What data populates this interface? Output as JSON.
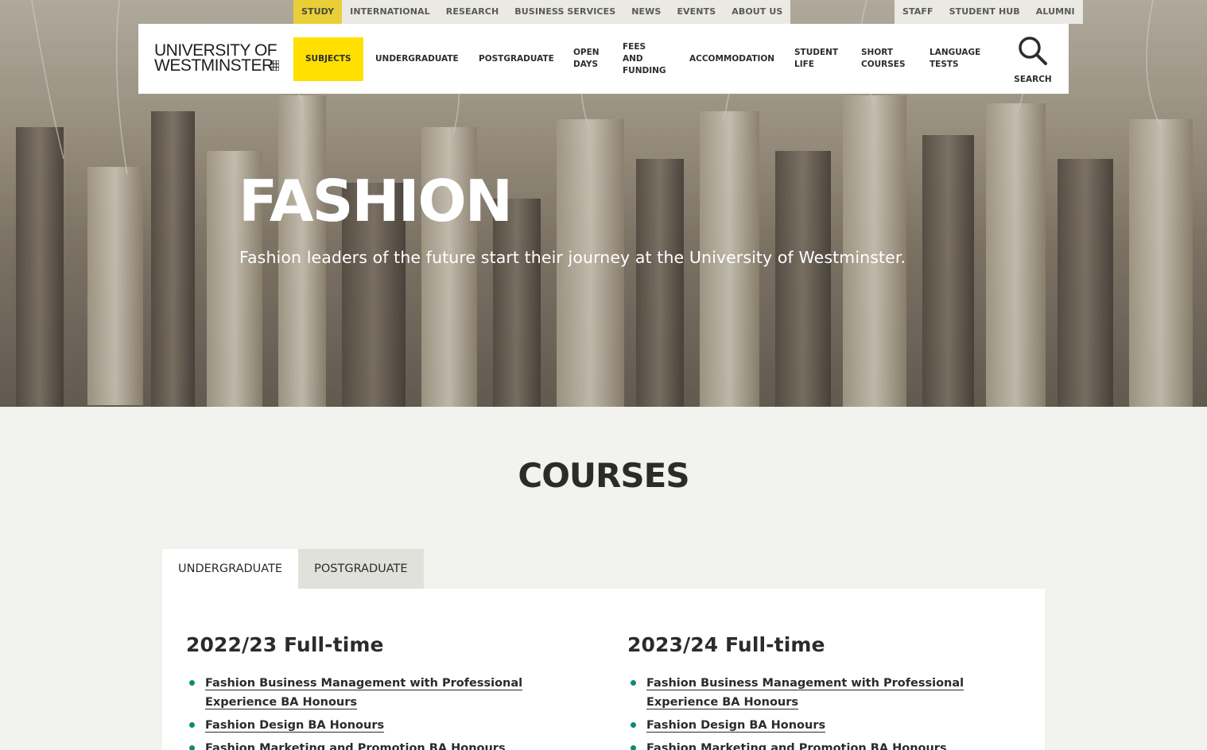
{
  "utility_left": [
    {
      "label": "STUDY",
      "active": true
    },
    {
      "label": "INTERNATIONAL"
    },
    {
      "label": "RESEARCH"
    },
    {
      "label": "BUSINESS SERVICES"
    },
    {
      "label": "NEWS"
    },
    {
      "label": "EVENTS"
    },
    {
      "label": "ABOUT US"
    }
  ],
  "utility_right": [
    {
      "label": "STAFF"
    },
    {
      "label": "STUDENT HUB"
    },
    {
      "label": "ALUMNI"
    }
  ],
  "logo": {
    "line1": "UNIVERSITY OF",
    "line2": "WESTMINSTER"
  },
  "nav": [
    {
      "label": "SUBJECTS",
      "active": true
    },
    {
      "label": "UNDERGRADUATE"
    },
    {
      "label": "POSTGRADUATE"
    },
    {
      "label": "OPEN\nDAYS"
    },
    {
      "label": "FEES\nAND\nFUNDING"
    },
    {
      "label": "ACCOMMODATION"
    },
    {
      "label": "STUDENT\nLIFE"
    },
    {
      "label": "SHORT\nCOURSES"
    },
    {
      "label": "LANGUAGE\nTESTS"
    }
  ],
  "search": {
    "label": "SEARCH",
    "icon": "search-icon"
  },
  "hero": {
    "title": "FASHION",
    "subtitle": "Fashion leaders of the future start their journey at the University of Westminster."
  },
  "courses": {
    "title": "COURSES",
    "tabs": [
      {
        "label": "UNDERGRADUATE",
        "active": true
      },
      {
        "label": "POSTGRADUATE"
      }
    ],
    "columns": [
      {
        "heading": "2022/23 Full-time",
        "items": [
          "Fashion Business Management with Professional Experience BA Honours",
          "Fashion Design BA Honours",
          "Fashion Marketing and Promotion BA Honours"
        ]
      },
      {
        "heading": "2023/24 Full-time",
        "items": [
          "Fashion Business Management with Professional Experience BA Honours",
          "Fashion Design BA Honours",
          "Fashion Marketing and Promotion BA Honours"
        ]
      }
    ]
  },
  "colors": {
    "accent_yellow": "#ffe000",
    "bullet_teal": "#0f8a78"
  }
}
